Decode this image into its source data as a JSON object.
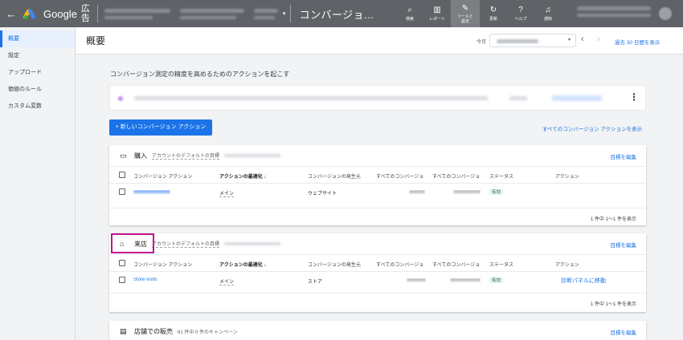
{
  "topbar": {
    "back_icon": "arrow-left-icon",
    "brand": "Google",
    "brand_ads": "広告",
    "page_title": "コンバージョ...",
    "tools": [
      {
        "icon": "search-icon",
        "glyph": "⌕",
        "label": "検索"
      },
      {
        "icon": "report-icon",
        "glyph": "▥",
        "label": "レポート"
      },
      {
        "icon": "wrench-icon",
        "glyph": "✎",
        "label": "ツールと設定"
      },
      {
        "icon": "refresh-icon",
        "glyph": "↻",
        "label": "更新"
      },
      {
        "icon": "help-icon",
        "glyph": "?",
        "label": "ヘルプ"
      },
      {
        "icon": "bell-icon",
        "glyph": "♫",
        "label": "通知"
      }
    ]
  },
  "sidebar": {
    "items": [
      {
        "label": "概要",
        "active": true
      },
      {
        "label": "設定",
        "active": false
      },
      {
        "label": "アップロード",
        "active": false
      },
      {
        "label": "価値のルール",
        "active": false
      },
      {
        "label": "カスタム変数",
        "active": false
      }
    ]
  },
  "header": {
    "title": "概要",
    "date_label": "今月",
    "period_link": "過去 30 日間を表示"
  },
  "main": {
    "section_title": "コンバージョン測定の精度を高めるためのアクションを起こす",
    "new_button": "+ 新しいコンバージョン アクション",
    "all_link": "すべてのコンバージョン アクションを表示"
  },
  "columns": [
    "コンバージョン アクション",
    "アクションの最適化 ↓",
    "コンバージョンの発生元",
    "すべてのコンバージョ",
    "すべてのコンバージョ",
    "ステータス",
    "アクション"
  ],
  "cards": {
    "purchase": {
      "icon": "credit-card-icon",
      "title": "購入",
      "subtitle": "アカウントのデフォルトの目標",
      "edit": "目標を編集",
      "row": {
        "optimization": "メイン",
        "source": "ウェブサイト",
        "status": "有効",
        "action": ""
      },
      "footer": "1 件中 1〜1 件を表示"
    },
    "store_visit": {
      "icon": "store-icon",
      "title": "来店",
      "subtitle": "アカウントのデフォルトの目標",
      "edit": "目標を編集",
      "row": {
        "name": "Store visits",
        "optimization": "メイン",
        "source": "ストア",
        "status": "有効",
        "action": "診断パネルに移動"
      },
      "footer": "1 件中 1〜1 件を表示"
    },
    "store_sales": {
      "icon": "receipt-icon",
      "title": "店舗での販売",
      "subtitle": "61 件中 0 件のキャンペーン",
      "edit": "目標を編集"
    }
  },
  "colors": {
    "accent": "#1a73e8",
    "highlight": "#c5128a",
    "topbar": "#5f6368"
  }
}
